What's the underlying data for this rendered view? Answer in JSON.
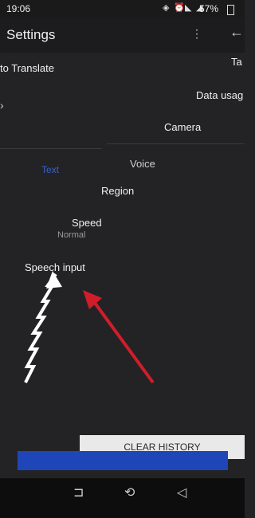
{
  "status": {
    "time": "19:06",
    "icons": [
      "vibrate-icon",
      "alarm-icon",
      "wifi-icon",
      "signal-icon"
    ],
    "battery": "57%"
  },
  "appbar": {
    "title": "Settings",
    "back_icon": "arrow-left-icon"
  },
  "rows": {
    "translate": "to Translate",
    "tap": "Ta",
    "data_usage": "Data usag",
    "camera": "Camera",
    "voice": "Voice",
    "region": "Region",
    "speed": "Speed",
    "speed_value": "Normal",
    "speech_input": "Speech input",
    "text_label": "Text"
  },
  "actions": {
    "clear_history": "CLEAR HISTORY"
  },
  "navbar": {
    "icons": [
      "recent-apps-icon",
      "home-icon",
      "back-icon"
    ]
  },
  "colors": {
    "background": "#232325",
    "accent_blue": "#1f46b8",
    "arrow_red": "#d11d2a"
  }
}
